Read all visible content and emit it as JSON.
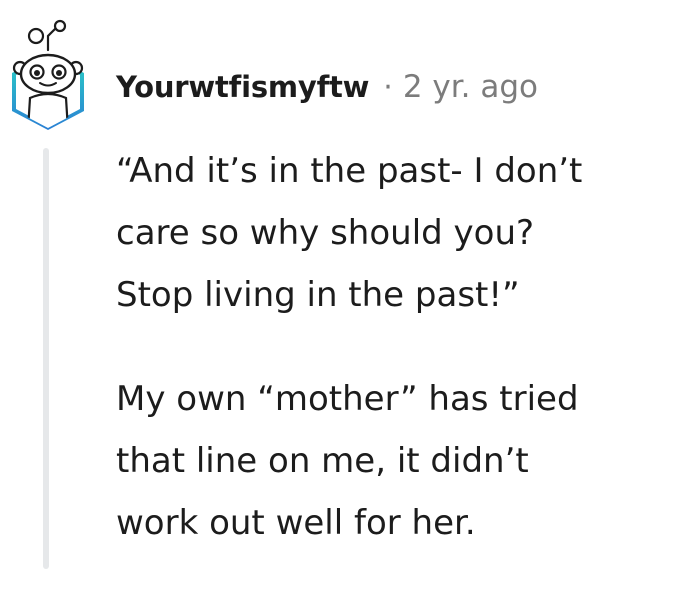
{
  "comment": {
    "username": "Yourwtfismyftw",
    "separator": "·",
    "age": "2 yr. ago",
    "paragraphs": [
      {
        "lines": [
          "“And it’s in the past- I don’t",
          "care so why should you?",
          "Stop living in the past!”"
        ]
      },
      {
        "lines": [
          "My own “mother” has tried",
          "that line on me, it didn’t",
          "work out well for her."
        ]
      }
    ]
  },
  "avatar": {
    "icon": "reddit-snoo-avatar-icon",
    "colors": {
      "frame_top": "#2bd4c4",
      "frame_bottom": "#2a7fd4",
      "face": "#ffffff",
      "outline": "#1c1c1c"
    }
  },
  "colors": {
    "text": "#1c1c1c",
    "muted": "#7c7c7c",
    "thread_line": "#e6e8ea"
  }
}
